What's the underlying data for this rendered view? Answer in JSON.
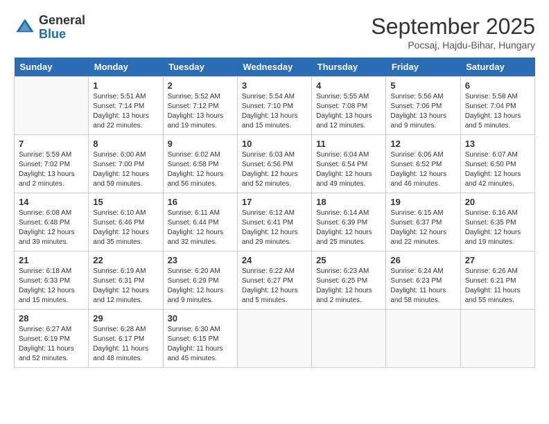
{
  "logo": {
    "line1": "General",
    "line2": "Blue"
  },
  "title": "September 2025",
  "subtitle": "Pocsaj, Hajdu-Bihar, Hungary",
  "days_of_week": [
    "Sunday",
    "Monday",
    "Tuesday",
    "Wednesday",
    "Thursday",
    "Friday",
    "Saturday"
  ],
  "weeks": [
    [
      {
        "day": "",
        "sunrise": "",
        "sunset": "",
        "daylight": ""
      },
      {
        "day": "1",
        "sunrise": "Sunrise: 5:51 AM",
        "sunset": "Sunset: 7:14 PM",
        "daylight": "Daylight: 13 hours and 22 minutes."
      },
      {
        "day": "2",
        "sunrise": "Sunrise: 5:52 AM",
        "sunset": "Sunset: 7:12 PM",
        "daylight": "Daylight: 13 hours and 19 minutes."
      },
      {
        "day": "3",
        "sunrise": "Sunrise: 5:54 AM",
        "sunset": "Sunset: 7:10 PM",
        "daylight": "Daylight: 13 hours and 15 minutes."
      },
      {
        "day": "4",
        "sunrise": "Sunrise: 5:55 AM",
        "sunset": "Sunset: 7:08 PM",
        "daylight": "Daylight: 13 hours and 12 minutes."
      },
      {
        "day": "5",
        "sunrise": "Sunrise: 5:56 AM",
        "sunset": "Sunset: 7:06 PM",
        "daylight": "Daylight: 13 hours and 9 minutes."
      },
      {
        "day": "6",
        "sunrise": "Sunrise: 5:58 AM",
        "sunset": "Sunset: 7:04 PM",
        "daylight": "Daylight: 13 hours and 5 minutes."
      }
    ],
    [
      {
        "day": "7",
        "sunrise": "Sunrise: 5:59 AM",
        "sunset": "Sunset: 7:02 PM",
        "daylight": "Daylight: 13 hours and 2 minutes."
      },
      {
        "day": "8",
        "sunrise": "Sunrise: 6:00 AM",
        "sunset": "Sunset: 7:00 PM",
        "daylight": "Daylight: 12 hours and 59 minutes."
      },
      {
        "day": "9",
        "sunrise": "Sunrise: 6:02 AM",
        "sunset": "Sunset: 6:58 PM",
        "daylight": "Daylight: 12 hours and 56 minutes."
      },
      {
        "day": "10",
        "sunrise": "Sunrise: 6:03 AM",
        "sunset": "Sunset: 6:56 PM",
        "daylight": "Daylight: 12 hours and 52 minutes."
      },
      {
        "day": "11",
        "sunrise": "Sunrise: 6:04 AM",
        "sunset": "Sunset: 6:54 PM",
        "daylight": "Daylight: 12 hours and 49 minutes."
      },
      {
        "day": "12",
        "sunrise": "Sunrise: 6:06 AM",
        "sunset": "Sunset: 6:52 PM",
        "daylight": "Daylight: 12 hours and 46 minutes."
      },
      {
        "day": "13",
        "sunrise": "Sunrise: 6:07 AM",
        "sunset": "Sunset: 6:50 PM",
        "daylight": "Daylight: 12 hours and 42 minutes."
      }
    ],
    [
      {
        "day": "14",
        "sunrise": "Sunrise: 6:08 AM",
        "sunset": "Sunset: 6:48 PM",
        "daylight": "Daylight: 12 hours and 39 minutes."
      },
      {
        "day": "15",
        "sunrise": "Sunrise: 6:10 AM",
        "sunset": "Sunset: 6:46 PM",
        "daylight": "Daylight: 12 hours and 35 minutes."
      },
      {
        "day": "16",
        "sunrise": "Sunrise: 6:11 AM",
        "sunset": "Sunset: 6:44 PM",
        "daylight": "Daylight: 12 hours and 32 minutes."
      },
      {
        "day": "17",
        "sunrise": "Sunrise: 6:12 AM",
        "sunset": "Sunset: 6:41 PM",
        "daylight": "Daylight: 12 hours and 29 minutes."
      },
      {
        "day": "18",
        "sunrise": "Sunrise: 6:14 AM",
        "sunset": "Sunset: 6:39 PM",
        "daylight": "Daylight: 12 hours and 25 minutes."
      },
      {
        "day": "19",
        "sunrise": "Sunrise: 6:15 AM",
        "sunset": "Sunset: 6:37 PM",
        "daylight": "Daylight: 12 hours and 22 minutes."
      },
      {
        "day": "20",
        "sunrise": "Sunrise: 6:16 AM",
        "sunset": "Sunset: 6:35 PM",
        "daylight": "Daylight: 12 hours and 19 minutes."
      }
    ],
    [
      {
        "day": "21",
        "sunrise": "Sunrise: 6:18 AM",
        "sunset": "Sunset: 6:33 PM",
        "daylight": "Daylight: 12 hours and 15 minutes."
      },
      {
        "day": "22",
        "sunrise": "Sunrise: 6:19 AM",
        "sunset": "Sunset: 6:31 PM",
        "daylight": "Daylight: 12 hours and 12 minutes."
      },
      {
        "day": "23",
        "sunrise": "Sunrise: 6:20 AM",
        "sunset": "Sunset: 6:29 PM",
        "daylight": "Daylight: 12 hours and 9 minutes."
      },
      {
        "day": "24",
        "sunrise": "Sunrise: 6:22 AM",
        "sunset": "Sunset: 6:27 PM",
        "daylight": "Daylight: 12 hours and 5 minutes."
      },
      {
        "day": "25",
        "sunrise": "Sunrise: 6:23 AM",
        "sunset": "Sunset: 6:25 PM",
        "daylight": "Daylight: 12 hours and 2 minutes."
      },
      {
        "day": "26",
        "sunrise": "Sunrise: 6:24 AM",
        "sunset": "Sunset: 6:23 PM",
        "daylight": "Daylight: 11 hours and 58 minutes."
      },
      {
        "day": "27",
        "sunrise": "Sunrise: 6:26 AM",
        "sunset": "Sunset: 6:21 PM",
        "daylight": "Daylight: 11 hours and 55 minutes."
      }
    ],
    [
      {
        "day": "28",
        "sunrise": "Sunrise: 6:27 AM",
        "sunset": "Sunset: 6:19 PM",
        "daylight": "Daylight: 11 hours and 52 minutes."
      },
      {
        "day": "29",
        "sunrise": "Sunrise: 6:28 AM",
        "sunset": "Sunset: 6:17 PM",
        "daylight": "Daylight: 11 hours and 48 minutes."
      },
      {
        "day": "30",
        "sunrise": "Sunrise: 6:30 AM",
        "sunset": "Sunset: 6:15 PM",
        "daylight": "Daylight: 11 hours and 45 minutes."
      },
      {
        "day": "",
        "sunrise": "",
        "sunset": "",
        "daylight": ""
      },
      {
        "day": "",
        "sunrise": "",
        "sunset": "",
        "daylight": ""
      },
      {
        "day": "",
        "sunrise": "",
        "sunset": "",
        "daylight": ""
      },
      {
        "day": "",
        "sunrise": "",
        "sunset": "",
        "daylight": ""
      }
    ]
  ]
}
